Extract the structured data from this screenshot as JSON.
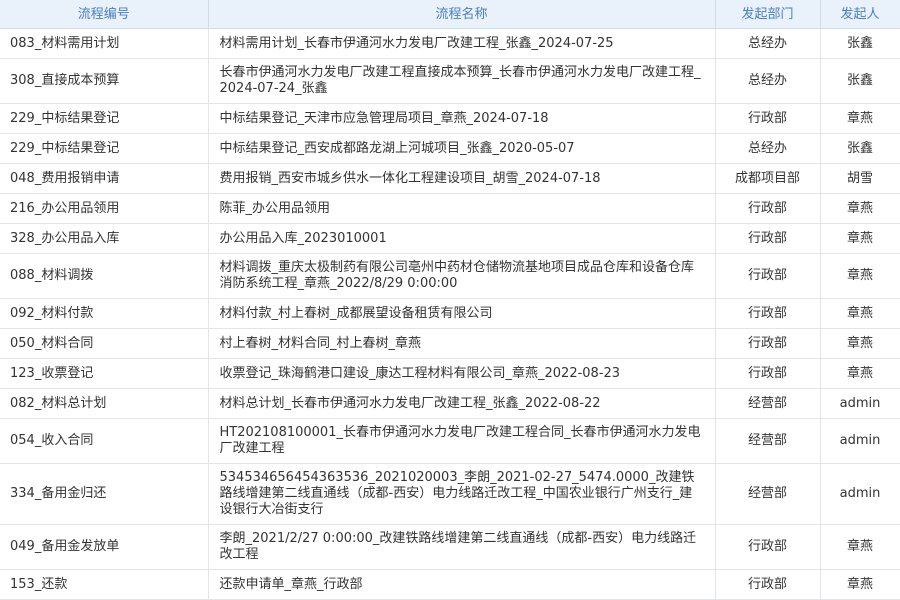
{
  "columns": {
    "code": "流程编号",
    "name": "流程名称",
    "dept": "发起部门",
    "initiator": "发起人"
  },
  "rows": [
    {
      "code": "083_材料需用计划",
      "name": "材料需用计划_长春市伊通河水力发电厂改建工程_张鑫_2024-07-25",
      "dept": "总经办",
      "initiator": "张鑫",
      "lines": 1
    },
    {
      "code": "308_直接成本预算",
      "name": "长春市伊通河水力发电厂改建工程直接成本预算_长春市伊通河水力发电厂改建工程_2024-07-24_张鑫",
      "dept": "总经办",
      "initiator": "张鑫",
      "lines": 2
    },
    {
      "code": "229_中标结果登记",
      "name": "中标结果登记_天津市应急管理局项目_章燕_2024-07-18",
      "dept": "行政部",
      "initiator": "章燕",
      "lines": 1
    },
    {
      "code": "229_中标结果登记",
      "name": "中标结果登记_西安成都路龙湖上河城项目_张鑫_2020-05-07",
      "dept": "总经办",
      "initiator": "张鑫",
      "lines": 1
    },
    {
      "code": "048_费用报销申请",
      "name": "费用报销_西安市城乡供水一体化工程建设项目_胡雪_2024-07-18",
      "dept": "成都项目部",
      "initiator": "胡雪",
      "lines": 1
    },
    {
      "code": "216_办公用品领用",
      "name": "陈菲_办公用品领用",
      "dept": "行政部",
      "initiator": "章燕",
      "lines": 1
    },
    {
      "code": "328_办公用品入库",
      "name": "办公用品入库_2023010001",
      "dept": "行政部",
      "initiator": "章燕",
      "lines": 1
    },
    {
      "code": "088_材料调拨",
      "name": "材料调拨_重庆太极制药有限公司亳州中药材仓储物流基地项目成品仓库和设备仓库消防系统工程_章燕_2022/8/29 0:00:00",
      "dept": "行政部",
      "initiator": "章燕",
      "lines": 2
    },
    {
      "code": "092_材料付款",
      "name": "材料付款_村上春树_成都展望设备租赁有限公司",
      "dept": "行政部",
      "initiator": "章燕",
      "lines": 1
    },
    {
      "code": "050_材料合同",
      "name": "村上春树_材料合同_村上春树_章燕",
      "dept": "行政部",
      "initiator": "章燕",
      "lines": 1
    },
    {
      "code": "123_收票登记",
      "name": "收票登记_珠海鹤港口建设_康达工程材料有限公司_章燕_2022-08-23",
      "dept": "行政部",
      "initiator": "章燕",
      "lines": 1
    },
    {
      "code": "082_材料总计划",
      "name": "材料总计划_长春市伊通河水力发电厂改建工程_张鑫_2022-08-22",
      "dept": "经营部",
      "initiator": "admin",
      "lines": 1
    },
    {
      "code": "054_收入合同",
      "name": "HT202108100001_长春市伊通河水力发电厂改建工程合同_长春市伊通河水力发电厂改建工程",
      "dept": "经营部",
      "initiator": "admin",
      "lines": 2
    },
    {
      "code": "334_备用金归还",
      "name": "534534656454363536_2021020003_李朗_2021-02-27_5474.0000_改建铁路线增建第二线直通线（成都-西安）电力线路迁改工程_中国农业银行广州支行_建设银行大冶街支行",
      "dept": "经营部",
      "initiator": "admin",
      "lines": 3
    },
    {
      "code": "049_备用金发放单",
      "name": "李朗_2021/2/27 0:00:00_改建铁路线增建第二线直通线（成都-西安）电力线路迁改工程",
      "dept": "行政部",
      "initiator": "章燕",
      "lines": 2
    },
    {
      "code": "153_还款",
      "name": "还款申请单_章燕_行政部",
      "dept": "行政部",
      "initiator": "章燕",
      "lines": 1
    }
  ]
}
